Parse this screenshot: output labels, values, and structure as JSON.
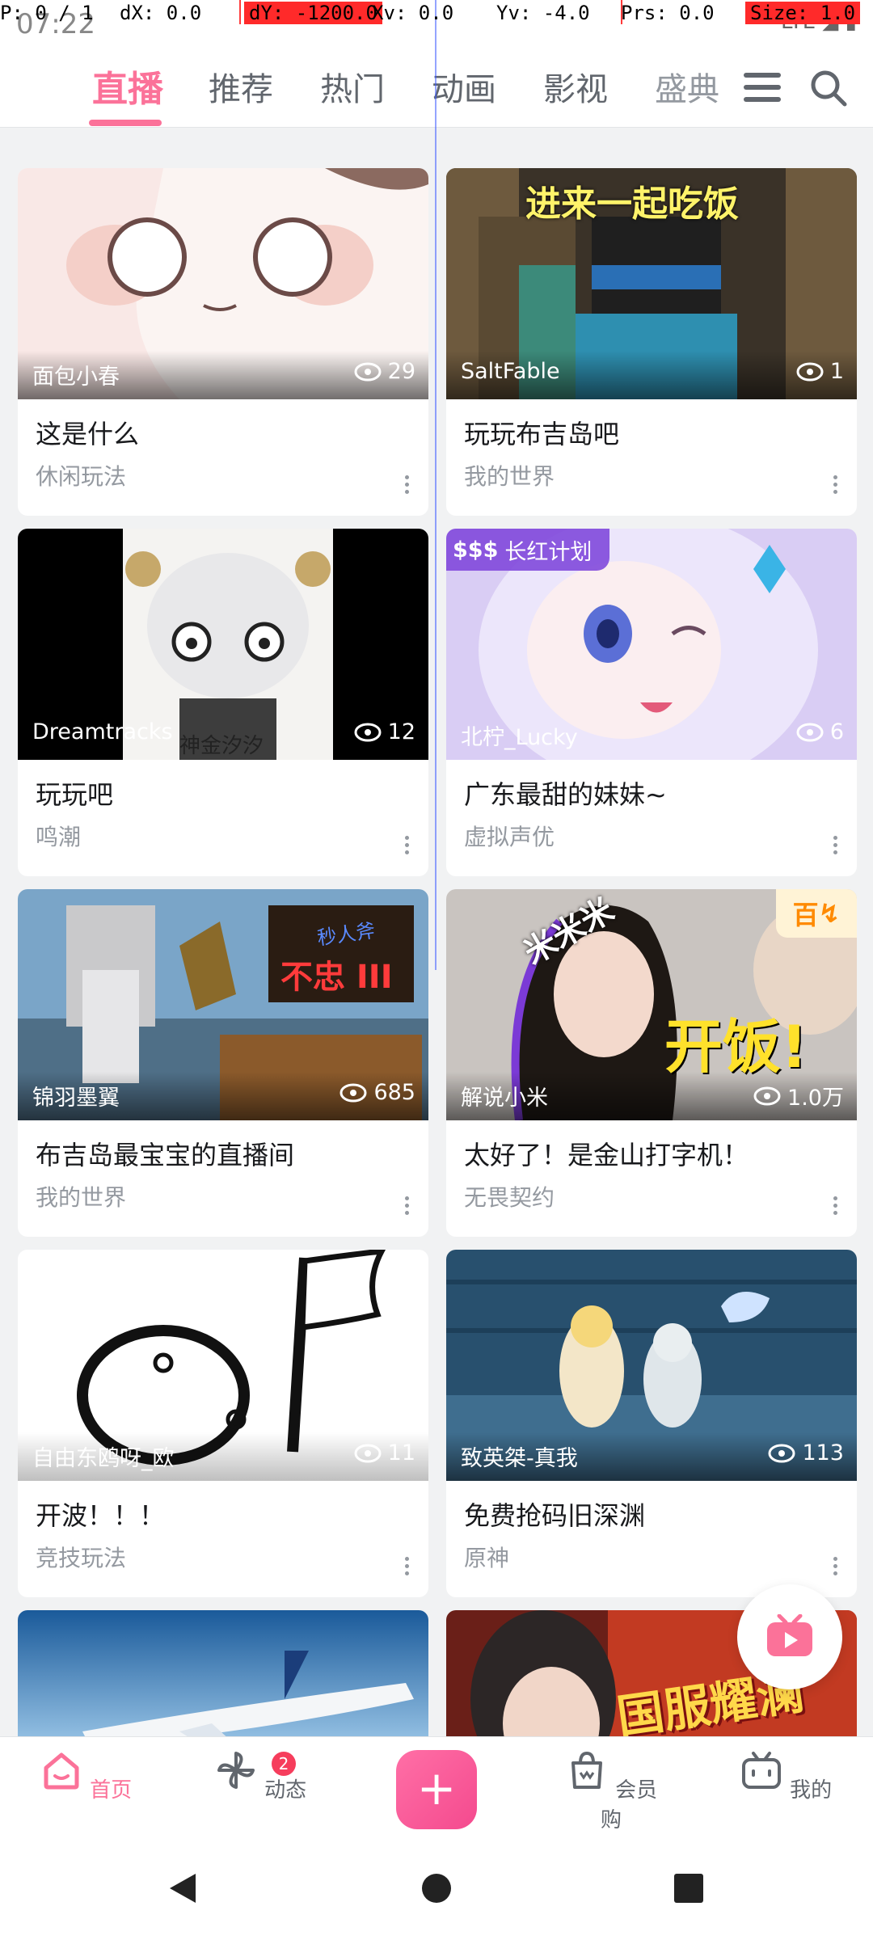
{
  "debug": {
    "p": "P: 0 / 1",
    "dx": "dX: 0.0",
    "dy": "dY: -1200.0",
    "xv": "Xv: 0.0",
    "yv": "Yv: -4.0",
    "prs": "Prs: 0.0",
    "size": "Size: 1.0"
  },
  "status": {
    "time": "07:22",
    "signal": "LTE"
  },
  "tabs": [
    {
      "label": "直播",
      "active": true
    },
    {
      "label": "推荐"
    },
    {
      "label": "热门"
    },
    {
      "label": "动画"
    },
    {
      "label": "影视"
    },
    {
      "label": "盛典"
    }
  ],
  "cards": [
    {
      "uname": "面包小春",
      "views": "29",
      "title": "这是什么",
      "sub": "休闲玩法"
    },
    {
      "uname": "SaltFable",
      "views": "1",
      "title": "玩玩布吉岛吧",
      "sub": "我的世界",
      "overlay": "进来一起吃饭"
    },
    {
      "uname": "Dreamtracks",
      "views": "12",
      "title": "玩玩吧",
      "sub": "鸣潮",
      "overlay": "神金汐汐"
    },
    {
      "uname": "北柠_Lucky",
      "views": "6",
      "title": "广东最甜的妹妹~",
      "sub": "虚拟声优",
      "badge": "长红计划"
    },
    {
      "uname": "锦羽墨翼",
      "views": "685",
      "title": "布吉岛最宝宝的直播间",
      "sub": "我的世界",
      "overlay": "不忠 III",
      "overlay_top": "秒人斧"
    },
    {
      "uname": "解说小米",
      "views": "1.0万",
      "title": "太好了！是金山打字机！",
      "sub": "无畏契约",
      "overlay": "开饭!",
      "overlay_top": "米米米",
      "badge": "百"
    },
    {
      "uname": "自由东鸥呀_欧",
      "views": "11",
      "title": "开波！！！",
      "sub": "竞技玩法"
    },
    {
      "uname": "致英桀-真我",
      "views": "113",
      "title": "免费抢码旧深渊",
      "sub": "原神"
    },
    {
      "overlay": "国服耀澜"
    }
  ],
  "bottomnav": [
    {
      "label": "首页",
      "active": true
    },
    {
      "label": "动态",
      "badge": "2"
    },
    {
      "label": "+"
    },
    {
      "label": "会员购"
    },
    {
      "label": "我的"
    }
  ],
  "colors": {
    "accent": "#fb7299",
    "bg": "#f1f2f3"
  }
}
